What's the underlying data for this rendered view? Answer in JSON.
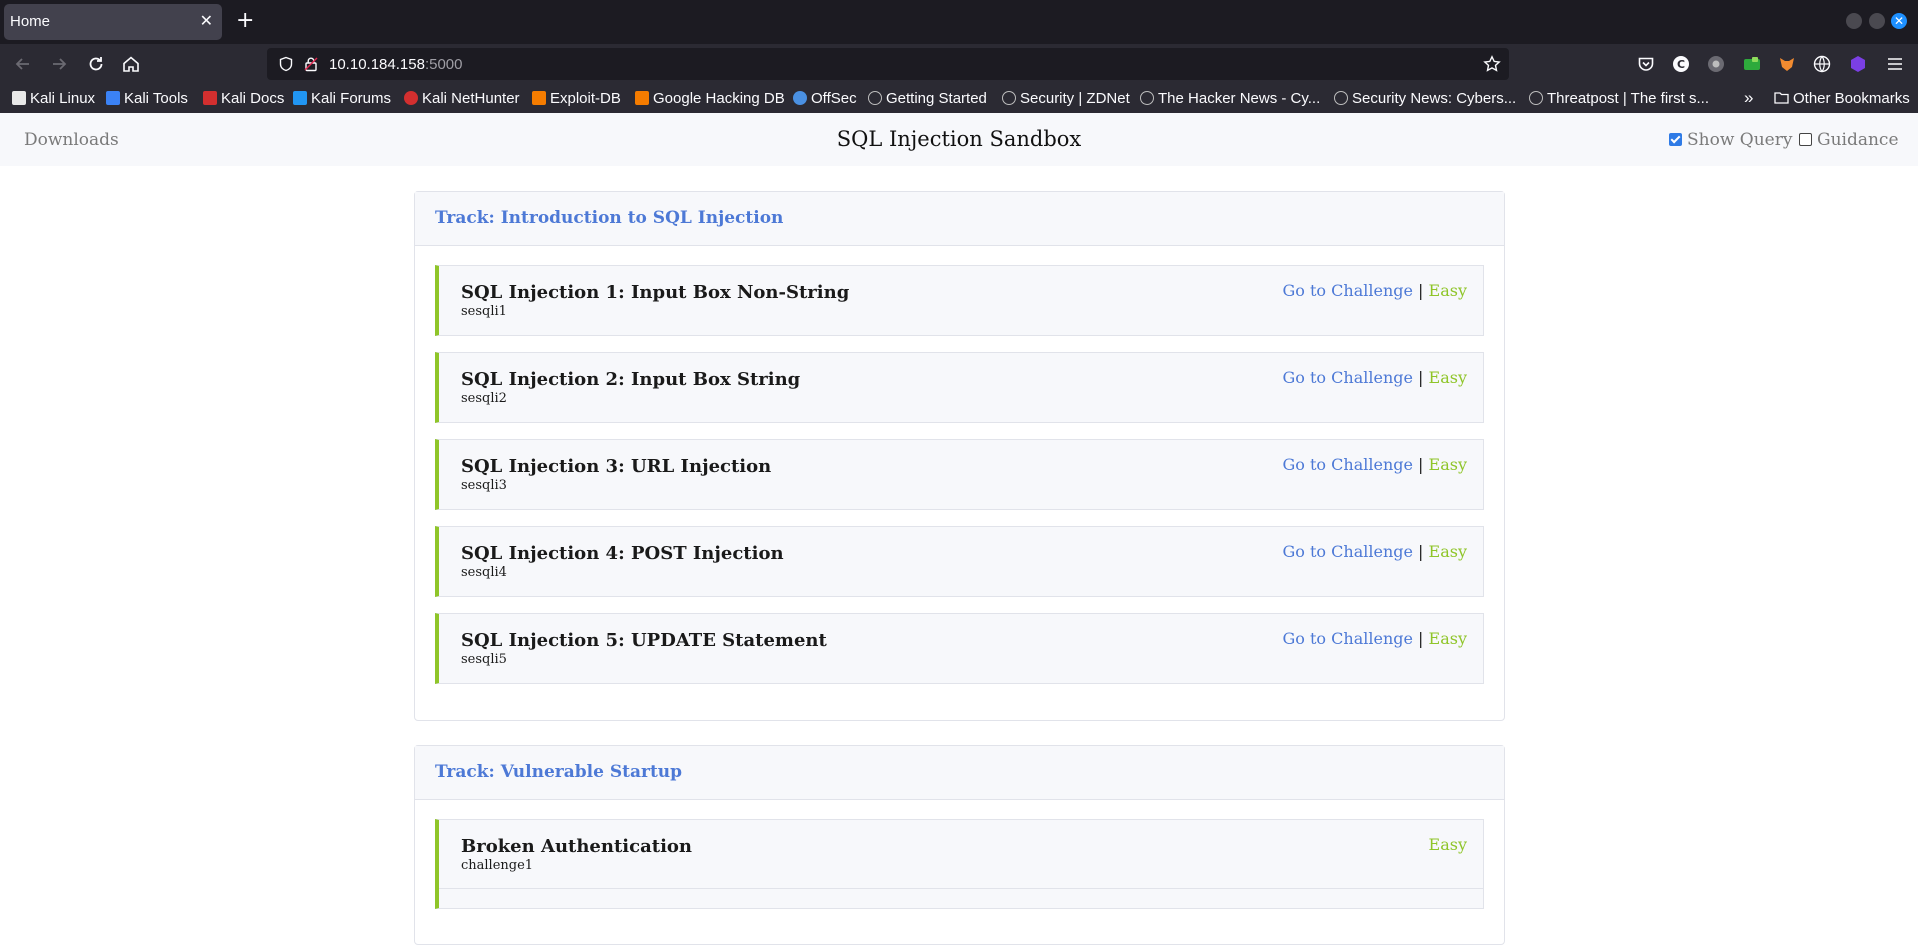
{
  "browser": {
    "tab_title": "Home",
    "tab_close": "✕",
    "new_tab": "+",
    "win_close": "✕",
    "url_host": "10.10.184.158",
    "url_port": ":5000",
    "bookmarks": [
      {
        "label": "Kali Linux",
        "icon": "kali-icon",
        "color": "#e8e8e8"
      },
      {
        "label": "Kali Tools",
        "icon": "kali-tools-icon",
        "color": "#3b82f6"
      },
      {
        "label": "Kali Docs",
        "icon": "kali-docs-icon",
        "color": "#d32f2f"
      },
      {
        "label": "Kali Forums",
        "icon": "kali-forums-icon",
        "color": "#2196f3"
      },
      {
        "label": "Kali NetHunter",
        "icon": "nethunter-icon",
        "color": "#d32f2f"
      },
      {
        "label": "Exploit-DB",
        "icon": "exploit-db-icon",
        "color": "#f57c00"
      },
      {
        "label": "Google Hacking DB",
        "icon": "ghdb-icon",
        "color": "#f57c00"
      },
      {
        "label": "OffSec",
        "icon": "offsec-icon",
        "color": "#4a90e2"
      },
      {
        "label": "Getting Started",
        "icon": "globe-icon",
        "color": "#bdbdbd"
      },
      {
        "label": "Security | ZDNet",
        "icon": "globe-icon",
        "color": "#bdbdbd"
      },
      {
        "label": "The Hacker News - Cy...",
        "icon": "globe-icon",
        "color": "#bdbdbd"
      },
      {
        "label": "Security News: Cybers...",
        "icon": "globe-icon",
        "color": "#bdbdbd"
      },
      {
        "label": "Threatpost | The first s...",
        "icon": "globe-icon",
        "color": "#bdbdbd"
      }
    ],
    "overflow": "»",
    "other_bookmarks": "Other Bookmarks"
  },
  "header": {
    "downloads": "Downloads",
    "title": "SQL Injection Sandbox",
    "show_query": "Show Query",
    "show_query_checked": true,
    "guidance": "Guidance",
    "guidance_checked": false
  },
  "tracks": [
    {
      "title": "Track: Introduction to SQL Injection",
      "challenges": [
        {
          "title": "SQL Injection 1: Input Box Non-String",
          "id": "sesqli1",
          "link": "Go to Challenge",
          "separator": "|",
          "difficulty": "Easy"
        },
        {
          "title": "SQL Injection 2: Input Box String",
          "id": "sesqli2",
          "link": "Go to Challenge",
          "separator": "|",
          "difficulty": "Easy"
        },
        {
          "title": "SQL Injection 3: URL Injection",
          "id": "sesqli3",
          "link": "Go to Challenge",
          "separator": "|",
          "difficulty": "Easy"
        },
        {
          "title": "SQL Injection 4: POST Injection",
          "id": "sesqli4",
          "link": "Go to Challenge",
          "separator": "|",
          "difficulty": "Easy"
        },
        {
          "title": "SQL Injection 5: UPDATE Statement",
          "id": "sesqli5",
          "link": "Go to Challenge",
          "separator": "|",
          "difficulty": "Easy"
        }
      ]
    },
    {
      "title": "Track: Vulnerable Startup",
      "challenges": [
        {
          "title": "Broken Authentication",
          "id": "challenge1",
          "difficulty": "Easy"
        }
      ]
    }
  ],
  "colors": {
    "accent_blue": "#4d79d6",
    "difficulty_green": "#8fc529"
  }
}
